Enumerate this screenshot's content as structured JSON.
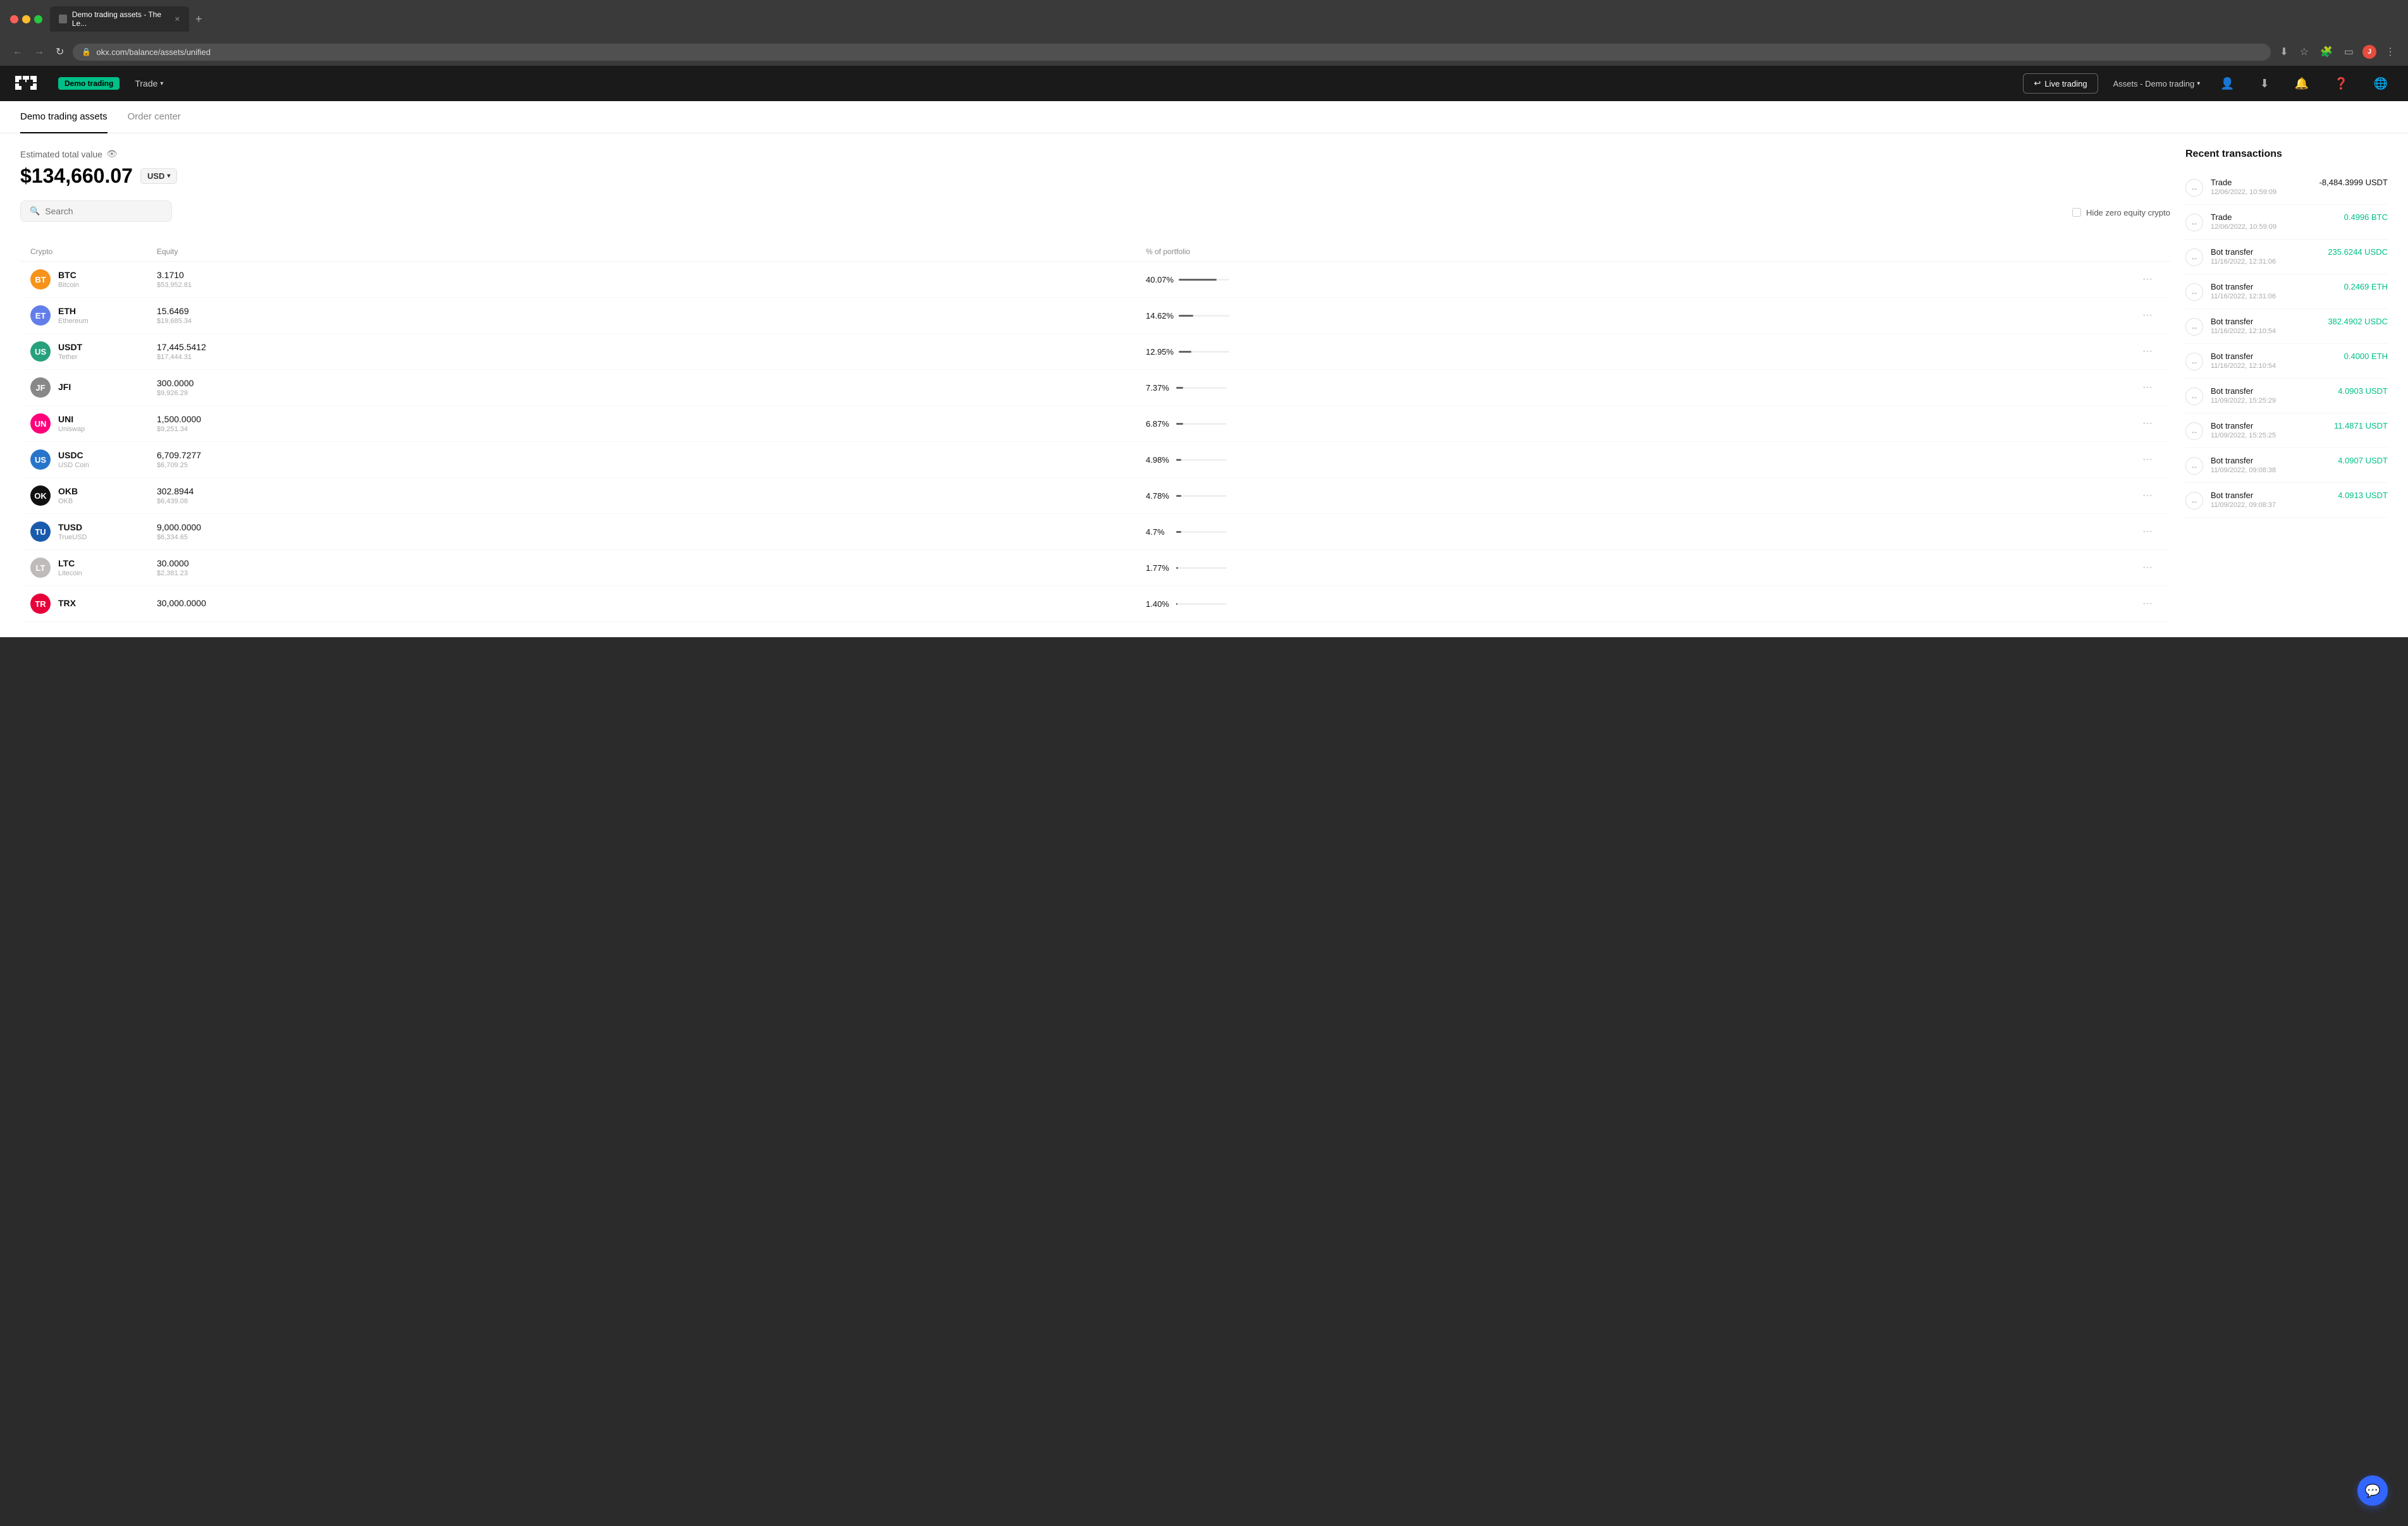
{
  "browser": {
    "tab_title": "Demo trading assets - The Le...",
    "new_tab_label": "+",
    "address": "okx.com/balance/assets/unified",
    "profile_initial": "J"
  },
  "header": {
    "demo_badge": "Demo trading",
    "trade_menu": "Trade",
    "live_trading_btn": "Live trading",
    "assets_menu": "Assets - Demo trading"
  },
  "page": {
    "tab_active": "Demo trading assets",
    "tab_inactive": "Order center"
  },
  "assets": {
    "estimated_label": "Estimated total value",
    "total_value": "$134,660.07",
    "currency": "USD",
    "search_placeholder": "Search",
    "hide_zero_label": "Hide zero equity crypto",
    "columns": {
      "crypto": "Crypto",
      "equity": "Equity",
      "portfolio": "% of portfolio"
    },
    "rows": [
      {
        "symbol": "BTC",
        "name": "Bitcoin",
        "equity": "3.1710",
        "usd": "$53,952.81",
        "pct": "40.07%",
        "pct_num": 40,
        "color": "#f7931a"
      },
      {
        "symbol": "ETH",
        "name": "Ethereum",
        "equity": "15.6469",
        "usd": "$19,685.34",
        "pct": "14.62%",
        "pct_num": 15,
        "color": "#627eea"
      },
      {
        "symbol": "USDT",
        "name": "Tether",
        "equity": "17,445.5412",
        "usd": "$17,444.31",
        "pct": "12.95%",
        "pct_num": 13,
        "color": "#26a17b"
      },
      {
        "symbol": "JFI",
        "name": "",
        "equity": "300.0000",
        "usd": "$9,926.29",
        "pct": "7.37%",
        "pct_num": 7,
        "color": "#888"
      },
      {
        "symbol": "UNI",
        "name": "Uniswap",
        "equity": "1,500.0000",
        "usd": "$9,251.34",
        "pct": "6.87%",
        "pct_num": 7,
        "color": "#ff007a"
      },
      {
        "symbol": "USDC",
        "name": "USD Coin",
        "equity": "6,709.7277",
        "usd": "$6,709.25",
        "pct": "4.98%",
        "pct_num": 5,
        "color": "#2775ca"
      },
      {
        "symbol": "OKB",
        "name": "OKB",
        "equity": "302.8944",
        "usd": "$6,439.08",
        "pct": "4.78%",
        "pct_num": 5,
        "color": "#111"
      },
      {
        "symbol": "TUSD",
        "name": "TrueUSD",
        "equity": "9,000.0000",
        "usd": "$6,334.65",
        "pct": "4.7%",
        "pct_num": 5,
        "color": "#1a5aad"
      },
      {
        "symbol": "LTC",
        "name": "Litecoin",
        "equity": "30.0000",
        "usd": "$2,381.23",
        "pct": "1.77%",
        "pct_num": 2,
        "color": "#bfbbbb"
      },
      {
        "symbol": "TRX",
        "name": "",
        "equity": "30,000.0000",
        "usd": "",
        "pct": "1.40%",
        "pct_num": 1,
        "color": "#e8003a"
      }
    ]
  },
  "transactions": {
    "title": "Recent transactions",
    "items": [
      {
        "type": "Trade",
        "date": "12/06/2022, 10:59:09",
        "amount": "-8,484.3999 USDT",
        "positive": false
      },
      {
        "type": "Trade",
        "date": "12/06/2022, 10:59:09",
        "amount": "0.4996 BTC",
        "positive": true
      },
      {
        "type": "Bot transfer",
        "date": "11/16/2022, 12:31:06",
        "amount": "235.6244 USDC",
        "positive": true
      },
      {
        "type": "Bot transfer",
        "date": "11/16/2022, 12:31:06",
        "amount": "0.2469 ETH",
        "positive": true
      },
      {
        "type": "Bot transfer",
        "date": "11/16/2022, 12:10:54",
        "amount": "382.4902 USDC",
        "positive": true
      },
      {
        "type": "Bot transfer",
        "date": "11/16/2022, 12:10:54",
        "amount": "0.4000 ETH",
        "positive": true
      },
      {
        "type": "Bot transfer",
        "date": "11/09/2022, 15:25:29",
        "amount": "4.0903 USDT",
        "positive": true
      },
      {
        "type": "Bot transfer",
        "date": "11/09/2022, 15:25:25",
        "amount": "11.4871 USDT",
        "positive": true
      },
      {
        "type": "Bot transfer",
        "date": "11/09/2022, 09:08:38",
        "amount": "4.0907 USDT",
        "positive": true
      },
      {
        "type": "Bot transfer",
        "date": "11/09/2022, 09:08:37",
        "amount": "4.0913 USDT",
        "positive": true
      }
    ]
  }
}
